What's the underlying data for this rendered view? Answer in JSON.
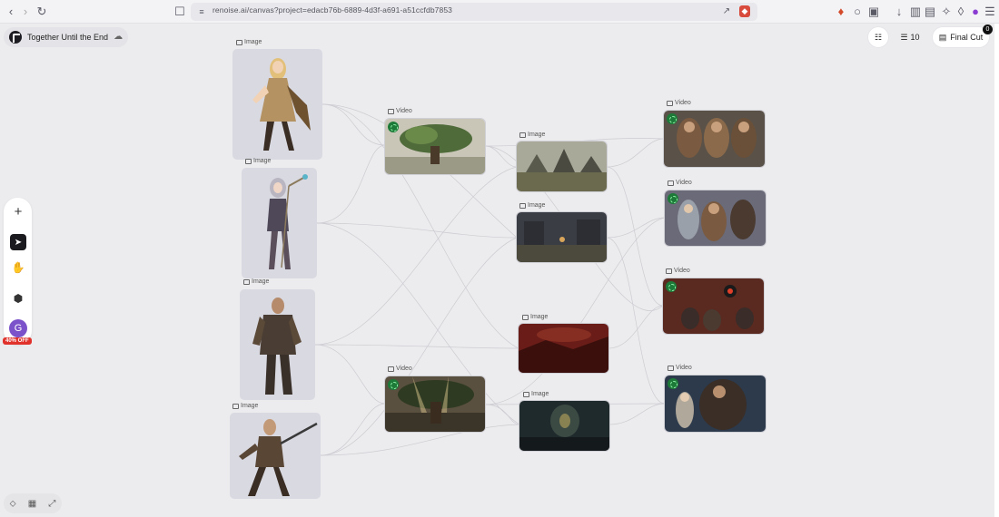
{
  "browser": {
    "url": "renoise.ai/canvas?project=edacb76b-6889-4d3f-a691-a51ccfdb7853"
  },
  "project": {
    "title": "Together Until the End"
  },
  "top_right": {
    "count_label": "10",
    "final_cut_label": "Final Cut",
    "final_cut_badge": "0"
  },
  "toolbar": {
    "avatar_initial": "G",
    "promo": "40% OFF"
  },
  "nodes": {
    "image_label": "Image",
    "video_label": "Video"
  },
  "colors": {
    "accent_green": "#1d7a38",
    "promo_red": "#e0312a",
    "avatar_purple": "#7b52c9"
  }
}
